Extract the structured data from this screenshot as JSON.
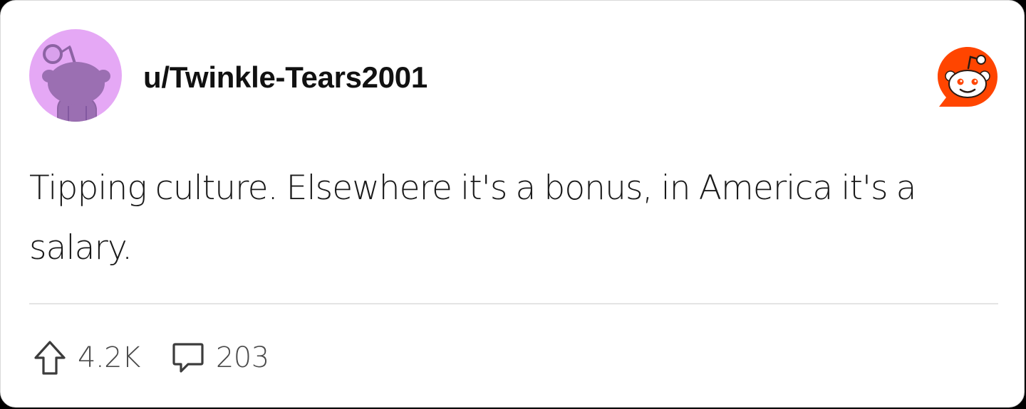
{
  "post": {
    "username": "u/Twinkle-Tears2001",
    "text": "Tipping culture. Elsewhere it's a bonus, in America it's a salary.",
    "upvotes": "4.2K",
    "comments": "203"
  },
  "icons": {
    "avatar": "snoo-avatar",
    "brand": "reddit-logo-icon",
    "upvote": "upvote-arrow-icon",
    "comments": "comment-bubble-icon"
  },
  "colors": {
    "avatar_bg": "#e5a8f5",
    "avatar_figure": "#9b6fb2",
    "brand": "#ff4500",
    "text": "#1a1a1a",
    "muted": "#4a4a4a"
  }
}
